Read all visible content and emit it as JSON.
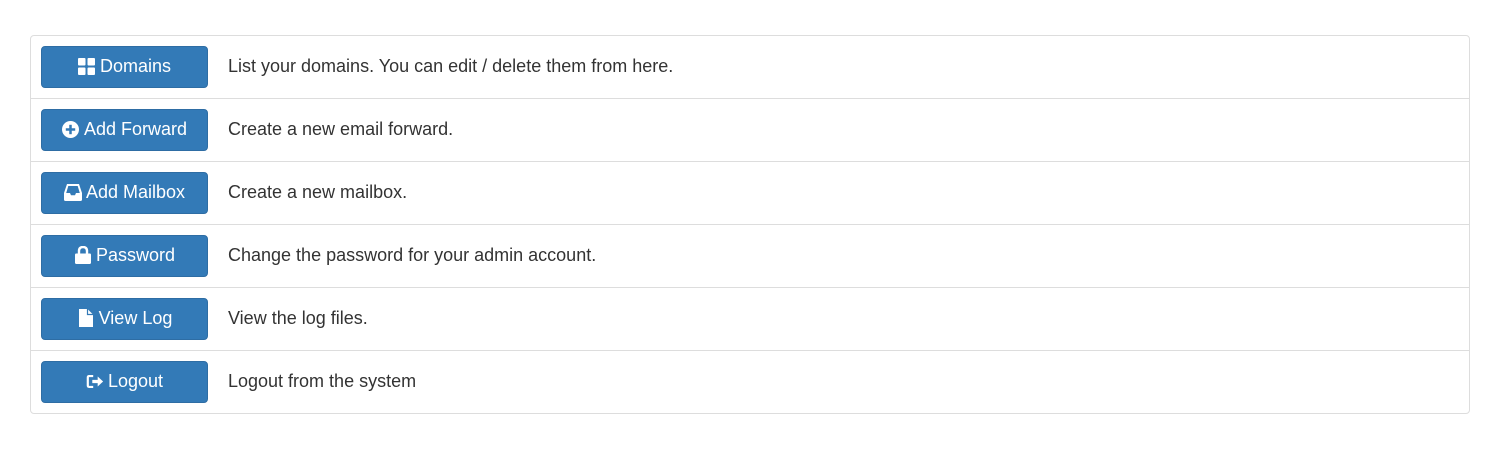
{
  "menu": {
    "items": [
      {
        "label": "Domains",
        "icon": "th-large-icon",
        "description": "List your domains. You can edit / delete them from here."
      },
      {
        "label": "Add Forward",
        "icon": "plus-circle-icon",
        "description": "Create a new email forward."
      },
      {
        "label": "Add Mailbox",
        "icon": "inbox-icon",
        "description": "Create a new mailbox."
      },
      {
        "label": "Password",
        "icon": "lock-icon",
        "description": "Change the password for your admin account."
      },
      {
        "label": "View Log",
        "icon": "file-icon",
        "description": "View the log files."
      },
      {
        "label": "Logout",
        "icon": "logout-icon",
        "description": "Logout from the system"
      }
    ]
  },
  "colors": {
    "button_bg": "#337ab7",
    "button_border": "#2e6da4",
    "button_text": "#ffffff",
    "description_text": "#333333",
    "divider": "#dddddd"
  }
}
